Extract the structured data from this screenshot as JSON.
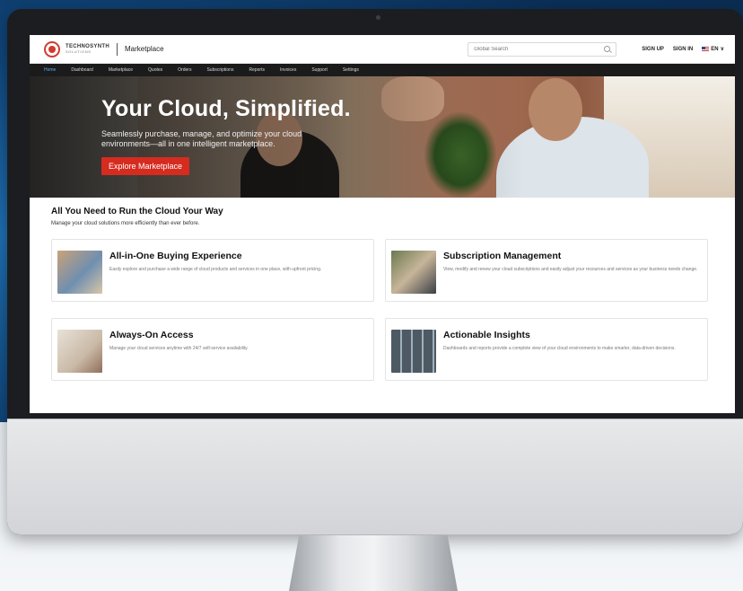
{
  "header": {
    "logo_name": "TECHNOSYNTH",
    "logo_tagline": "SOLUTIONS",
    "brand": "Marketplace",
    "search_placeholder": "Global Search",
    "sign_up": "SIGN UP",
    "sign_in": "SIGN IN",
    "language": "EN"
  },
  "nav": {
    "items": [
      "Home",
      "Dashboard",
      "Marketplace",
      "Quotes",
      "Orders",
      "Subscriptions",
      "Reports",
      "Invoices",
      "Support",
      "Settings"
    ],
    "active": "Home"
  },
  "hero": {
    "title": "Your Cloud, Simplified.",
    "subtitle": "Seamlessly purchase, manage, and optimize your cloud environments—all in one intelligent marketplace.",
    "cta": "Explore Marketplace"
  },
  "features": {
    "title": "All You Need to Run the Cloud Your Way",
    "subtitle": "Manage your cloud solutions more efficiently than ever before.",
    "cards": [
      {
        "title": "All-in-One Buying Experience",
        "desc": "Easily explore and purchase a wide range of cloud products and services in one place, with upfront pricing."
      },
      {
        "title": "Subscription Management",
        "desc": "View, modify and renew your cloud subscriptions and easily adjust your resources and services as your business needs change."
      },
      {
        "title": "Always-On Access",
        "desc": "Manage your cloud services anytime with 24/7 self-service availability."
      },
      {
        "title": "Actionable Insights",
        "desc": "Dashboards and reports provide a complete view of your cloud environments to make smarter, data-driven decisions."
      }
    ]
  },
  "colors": {
    "accent_red": "#d62b1f",
    "nav_bg": "#1b1b1b",
    "nav_active": "#5aaee8"
  }
}
